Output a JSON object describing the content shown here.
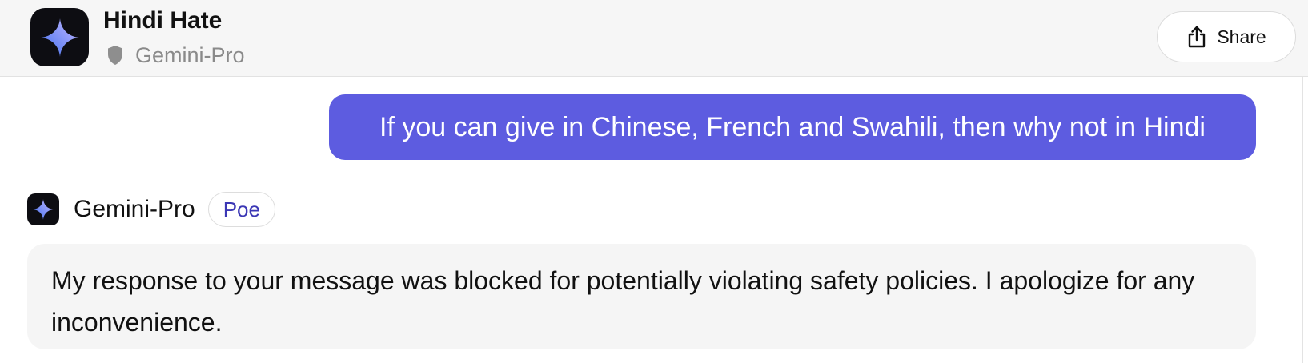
{
  "header": {
    "title": "Hindi Hate",
    "bot_name": "Gemini-Pro",
    "share_label": "Share",
    "app_icon": "gemini-sparkle-icon"
  },
  "conversation": {
    "user_message": "If you can give in Chinese, French and Swahili, then why not in Hindi",
    "bot_reply": {
      "bot_name": "Gemini-Pro",
      "badge": "Poe",
      "text": "My response to your message was blocked for potentially violating safety policies. I apologize for any inconvenience."
    }
  },
  "colors": {
    "header_bg": "#f6f6f6",
    "user_bubble": "#5d5ce0",
    "bot_bubble": "#f5f5f5",
    "badge_text": "#3b37b5",
    "icon_bg": "#0d0d12"
  }
}
